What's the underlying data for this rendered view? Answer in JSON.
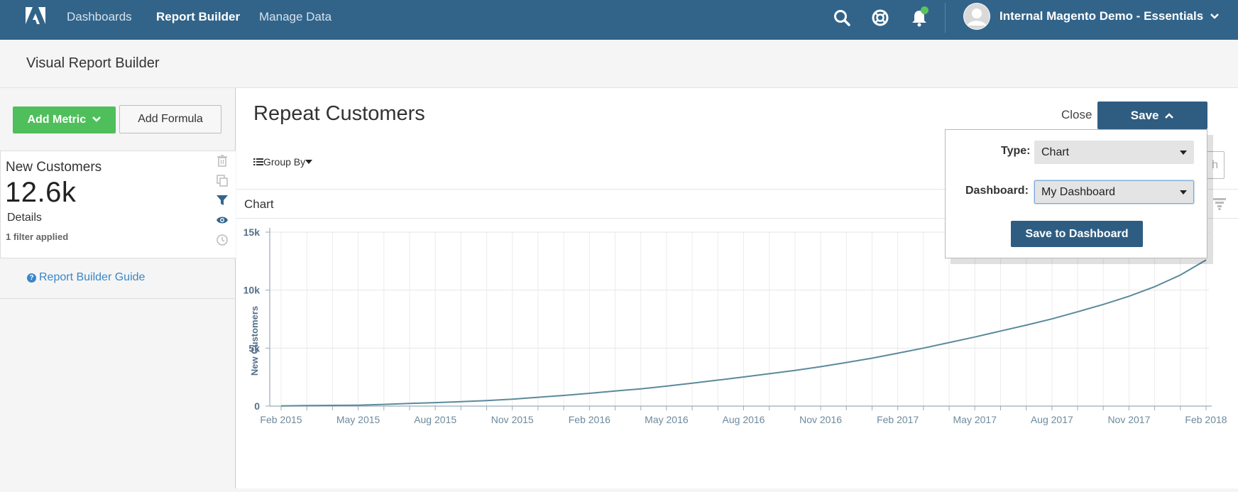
{
  "nav": {
    "links": [
      "Dashboards",
      "Report Builder",
      "Manage Data"
    ],
    "account": "Internal Magento Demo - Essentials",
    "icons": [
      "adobe-logo-icon",
      "search-icon",
      "help-lifebuoy-icon",
      "bell-icon",
      "avatar",
      "chevron-down-icon"
    ],
    "accent_color": "#32648a",
    "notification_color": "#5bc35b"
  },
  "subheader": {
    "title": "Visual Report Builder"
  },
  "sidebar": {
    "add_metric_label": "Add Metric",
    "add_formula_label": "Add Formula",
    "metric": {
      "name": "New Customers",
      "value": "12.6k",
      "details_label": "Details",
      "filter_text": "1 filter applied",
      "icons": [
        "trash-icon",
        "copy-icon",
        "filter-icon",
        "eye-icon",
        "clock-icon"
      ]
    },
    "guide_label": "Report Builder Guide"
  },
  "main": {
    "report_title": "Repeat Customers",
    "group_by_label": "Group By",
    "close_label": "Close",
    "save_label": "Save",
    "chart_tab_label": "Chart",
    "ghost_button_fragment": "h"
  },
  "popover": {
    "type_label": "Type:",
    "type_value": "Chart",
    "dashboard_label": "Dashboard:",
    "dashboard_value": "My Dashboard",
    "save_button_label": "Save to Dashboard"
  },
  "chart_data": {
    "type": "line",
    "ylabel": "New Customers",
    "xlabel": "",
    "ylim": [
      0,
      15000
    ],
    "yticks": [
      0,
      5000,
      10000,
      15000
    ],
    "ytick_labels": [
      "0",
      "5k",
      "10k",
      "15k"
    ],
    "x_labels": [
      "Feb 2015",
      "May 2015",
      "Aug 2015",
      "Nov 2015",
      "Feb 2016",
      "May 2016",
      "Aug 2016",
      "Nov 2016",
      "Feb 2017",
      "May 2017",
      "Aug 2017",
      "Nov 2017",
      "Feb 2018"
    ],
    "x": [
      "Feb 2015",
      "Mar 2015",
      "Apr 2015",
      "May 2015",
      "Jun 2015",
      "Jul 2015",
      "Aug 2015",
      "Sep 2015",
      "Oct 2015",
      "Nov 2015",
      "Dec 2015",
      "Jan 2016",
      "Feb 2016",
      "Mar 2016",
      "Apr 2016",
      "May 2016",
      "Jun 2016",
      "Jul 2016",
      "Aug 2016",
      "Sep 2016",
      "Oct 2016",
      "Nov 2016",
      "Dec 2016",
      "Jan 2017",
      "Feb 2017",
      "Mar 2017",
      "Apr 2017",
      "May 2017",
      "Jun 2017",
      "Jul 2017",
      "Aug 2017",
      "Sep 2017",
      "Oct 2017",
      "Nov 2017",
      "Dec 2017",
      "Jan 2018",
      "Feb 2018"
    ],
    "series": [
      {
        "values": [
          20,
          40,
          60,
          80,
          150,
          230,
          300,
          380,
          480,
          600,
          760,
          920,
          1100,
          1300,
          1490,
          1720,
          1980,
          2240,
          2510,
          2790,
          3080,
          3400,
          3760,
          4130,
          4560,
          5000,
          5480,
          5960,
          6470,
          6980,
          7520,
          8130,
          8770,
          9470,
          10300,
          11300,
          12600
        ],
        "color": "#5b8a9a"
      }
    ],
    "grid": true,
    "legend": "none"
  }
}
